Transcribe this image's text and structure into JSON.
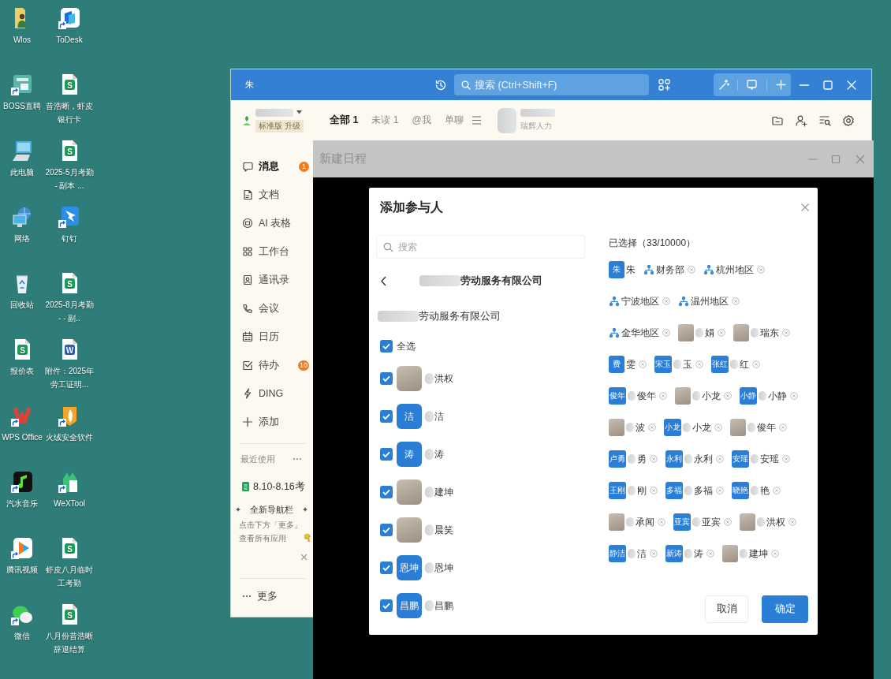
{
  "desktop": {
    "icons": [
      {
        "label": "Wlos"
      },
      {
        "label": "BOSS直聘"
      },
      {
        "label": "此电脑"
      },
      {
        "label": "网络"
      },
      {
        "label": "回收站"
      },
      {
        "label": "报价表",
        "badge": "S"
      },
      {
        "label": "WPS Office"
      },
      {
        "label": "汽水音乐"
      },
      {
        "label": "腾讯视频"
      },
      {
        "label": "微信"
      },
      {
        "label": "ToDesk"
      },
      {
        "label": "昔浩晰，虾皮银行卡",
        "badge": "S"
      },
      {
        "label": "2025-5月考勤 - 副本 ...",
        "badge": "S"
      },
      {
        "label": "钉钉"
      },
      {
        "label": "2025-8月考勤 - - 副..",
        "badge": "S"
      },
      {
        "label": "附件：2025年劳工证明...",
        "badge": "W"
      },
      {
        "label": "火绒安全软件"
      },
      {
        "label": "WeXTool"
      },
      {
        "label": "虾皮八月临时工考勤",
        "badge": "S"
      },
      {
        "label": "八月份昔浩晰辞退结算",
        "badge": "S"
      }
    ]
  },
  "app": {
    "title_bar": {
      "avatar": "朱",
      "search": {
        "placeholder": "搜索 (Ctrl+Shift+F)"
      }
    },
    "header": {
      "org": {
        "redacted": true,
        "plan": "标准版 升级"
      },
      "tabs": [
        {
          "label": "全部 1",
          "selected": true
        },
        {
          "label": "未读 1",
          "selected": false
        },
        {
          "label": "@我",
          "selected": false
        },
        {
          "label": "单聊",
          "selected": false
        }
      ],
      "chat": {
        "redacted": true,
        "subtitle": "瑞辉人力"
      }
    },
    "sidebar": {
      "items": [
        {
          "label": "消息",
          "selected": true,
          "badge": "1"
        },
        {
          "label": "文档",
          "selected": false
        },
        {
          "label": "AI 表格",
          "selected": false
        },
        {
          "label": "工作台",
          "selected": false
        },
        {
          "label": "通讯录",
          "selected": false
        },
        {
          "label": "会议",
          "selected": false
        },
        {
          "label": "日历",
          "selected": false
        },
        {
          "label": "待办",
          "selected": false,
          "badge": "10"
        },
        {
          "label": "DING",
          "selected": false
        },
        {
          "label": "添加",
          "selected": false
        }
      ],
      "recent": {
        "title": "最近使用",
        "items": [
          {
            "label": "8.10-8.16考"
          }
        ]
      },
      "promo": {
        "title": "全新导航栏",
        "text": "点击下方「更多」查看所有应用"
      },
      "more": "更多"
    }
  },
  "schedule_window": {
    "title": "新建日程",
    "dialog": {
      "title": "添加参与人",
      "search": {
        "placeholder": "搜索"
      },
      "breadcrumb": {
        "redacted": true,
        "label": "劳动服务有限公司"
      },
      "org": {
        "redacted": true,
        "label": "劳动服务有限公司"
      },
      "select_all": {
        "label": "全选",
        "checked": true
      },
      "members": [
        {
          "kind": "photo",
          "name": "洪权",
          "redacted": true,
          "checked": true
        },
        {
          "kind": "tile",
          "tile": "洁",
          "name": "洁",
          "redacted": true,
          "checked": true
        },
        {
          "kind": "tile",
          "tile": "涛",
          "name": "涛",
          "redacted": true,
          "checked": true
        },
        {
          "kind": "photo",
          "name": "建坤",
          "redacted": true,
          "checked": true
        },
        {
          "kind": "photo",
          "name": "晨笑",
          "redacted": true,
          "checked": true
        },
        {
          "kind": "tile",
          "tile": "恩坤",
          "name": "恩坤",
          "redacted": true,
          "checked": true
        },
        {
          "kind": "tile",
          "tile": "昌鹏",
          "name": "昌鹏",
          "redacted": true,
          "checked": true
        }
      ],
      "selected_title": "已选择（33/10000）",
      "selected": [
        {
          "kind": "tile",
          "tile": "朱",
          "name": "朱",
          "removable": false
        },
        {
          "kind": "org",
          "name": "财务部",
          "removable": true
        },
        {
          "kind": "org",
          "name": "杭州地区",
          "removable": true
        },
        {
          "kind": "org",
          "name": "宁波地区",
          "removable": true
        },
        {
          "kind": "org",
          "name": "温州地区",
          "removable": true
        },
        {
          "kind": "org",
          "name": "金华地区",
          "removable": true
        },
        {
          "kind": "photo",
          "name": "娟",
          "redacted": true,
          "removable": true
        },
        {
          "kind": "photo",
          "name": "瑞东",
          "redacted": true,
          "removable": true
        },
        {
          "kind": "tile",
          "tile": "费",
          "name": "雯",
          "removable": true
        },
        {
          "kind": "tile",
          "tile": "宋玉",
          "name": "玉",
          "redacted": true,
          "removable": true
        },
        {
          "kind": "tile",
          "tile": "张红",
          "name": "红",
          "redacted": true,
          "removable": true
        },
        {
          "kind": "tile",
          "tile": "俊年",
          "name": "俊年",
          "redacted": true,
          "removable": true
        },
        {
          "kind": "photo",
          "name": "小龙",
          "redacted": true,
          "removable": true
        },
        {
          "kind": "tile",
          "tile": "小静",
          "name": "小静",
          "redacted": true,
          "removable": true
        },
        {
          "kind": "photo",
          "name": "波",
          "redacted": true,
          "removable": true
        },
        {
          "kind": "tile",
          "tile": "小龙",
          "name": "小龙",
          "redacted": true,
          "removable": true
        },
        {
          "kind": "photo",
          "name": "俊年",
          "redacted": true,
          "removable": true
        },
        {
          "kind": "tile",
          "tile": "卢勇",
          "name": "勇",
          "redacted": true,
          "removable": true
        },
        {
          "kind": "tile",
          "tile": "永利",
          "name": "永利",
          "redacted": true,
          "removable": true
        },
        {
          "kind": "tile",
          "tile": "安瑶",
          "name": "安瑶",
          "redacted": true,
          "removable": true
        },
        {
          "kind": "tile",
          "tile": "王刚",
          "name": "刚",
          "redacted": true,
          "removable": true
        },
        {
          "kind": "tile",
          "tile": "多福",
          "name": "多福",
          "redacted": true,
          "removable": true
        },
        {
          "kind": "tile",
          "tile": "晓艳",
          "name": "艳",
          "redacted": true,
          "removable": true
        },
        {
          "kind": "photo",
          "name": "承闻",
          "redacted": true,
          "removable": true
        },
        {
          "kind": "tile",
          "tile": "亚宾",
          "name": "亚宾",
          "redacted": true,
          "removable": true
        },
        {
          "kind": "photo",
          "name": "洪权",
          "redacted": true,
          "removable": true
        },
        {
          "kind": "tile",
          "tile": "静洁",
          "name": "洁",
          "redacted": true,
          "removable": true
        },
        {
          "kind": "tile",
          "tile": "新涛",
          "name": "涛",
          "redacted": true,
          "removable": true
        },
        {
          "kind": "photo",
          "name": "建坤",
          "redacted": true,
          "removable": true
        }
      ],
      "buttons": [
        {
          "label": "取消",
          "kind": "secondary"
        },
        {
          "label": "确定",
          "kind": "primary"
        }
      ]
    }
  }
}
